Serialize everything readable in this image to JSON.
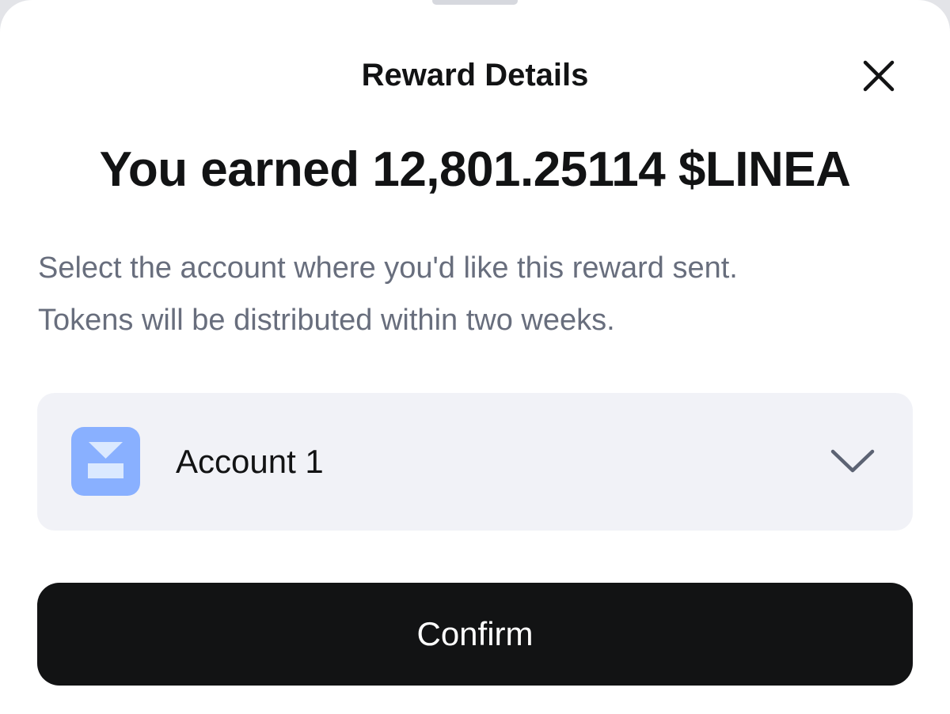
{
  "modal": {
    "title": "Reward Details",
    "close_icon": "close-icon"
  },
  "reward": {
    "headline": "You earned 12,801.25114 $LINEA",
    "description_line1": "Select the account where you'd like this reward sent.",
    "description_line2": "Tokens will be distributed within two weeks."
  },
  "account_select": {
    "selected_label": "Account 1",
    "avatar_icon": "account-avatar-icon",
    "chevron_icon": "chevron-down-icon"
  },
  "actions": {
    "confirm_label": "Confirm"
  },
  "colors": {
    "primary_text": "#121314",
    "secondary_text": "#686e7d",
    "select_background": "#f1f2f7",
    "button_background": "#121314",
    "avatar_background": "#89b0ff"
  }
}
